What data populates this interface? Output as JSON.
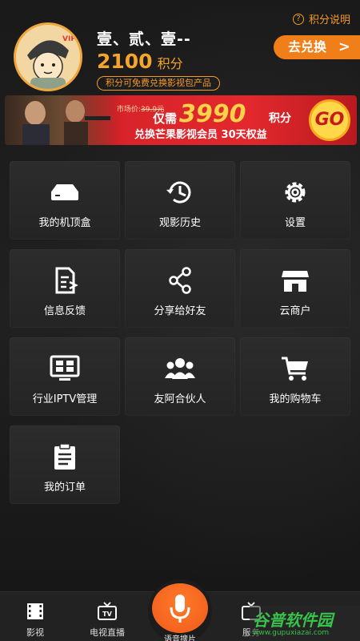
{
  "header": {
    "help_label": "积分说明",
    "username": "壹、贰、壹--",
    "points_value": "2100",
    "points_unit": "积分",
    "points_tip": "积分可免费兑换影视包产品",
    "exchange_label": "去兑换",
    "avatar_badge": "VIP"
  },
  "banner": {
    "market_prefix": "市场价:",
    "market_price": "39.9元",
    "only_label": "仅需",
    "points": "3990",
    "points_unit": "积分",
    "desc": "兑换芒果影视会员 30天权益",
    "go_label": "GO"
  },
  "tiles": [
    {
      "label": "我的机顶盒",
      "icon": "set-top-box-icon"
    },
    {
      "label": "观影历史",
      "icon": "history-clock-icon"
    },
    {
      "label": "设置",
      "icon": "gear-icon"
    },
    {
      "label": "信息反馈",
      "icon": "feedback-document-icon"
    },
    {
      "label": "分享给好友",
      "icon": "share-icon"
    },
    {
      "label": "云商户",
      "icon": "store-icon"
    },
    {
      "label": "行业IPTV管理",
      "icon": "iptv-monitor-icon"
    },
    {
      "label": "友阿合伙人",
      "icon": "partners-group-icon"
    },
    {
      "label": "我的购物车",
      "icon": "shopping-cart-icon"
    },
    {
      "label": "我的订单",
      "icon": "clipboard-icon"
    }
  ],
  "bottom_nav": {
    "items": [
      {
        "label": "影视",
        "icon": "film-icon"
      },
      {
        "label": "电视直播",
        "icon": "tv-icon"
      },
      {
        "label": "服务",
        "icon": "tv-icon"
      }
    ],
    "voice_label": "语音搜片"
  },
  "watermark": {
    "title": "谷普软件园",
    "url": "www.gupuxiazai.com"
  },
  "colors": {
    "accent": "#f07e19",
    "background": "#1b1b1b",
    "tile": "#2a2a2a",
    "banner_red": "#d8242a"
  }
}
